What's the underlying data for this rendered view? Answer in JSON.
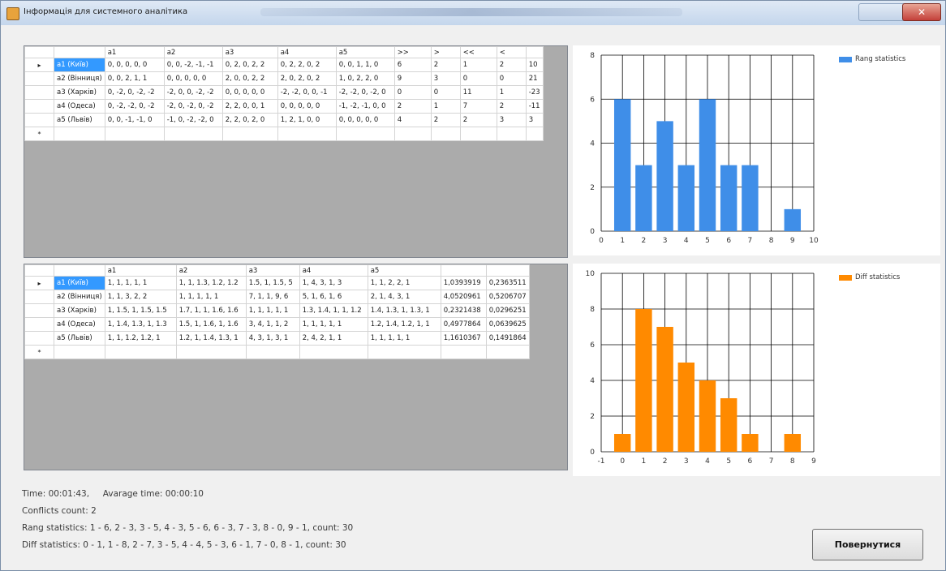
{
  "window": {
    "title": "Інформація для системного аналітика",
    "close_glyph": "✕"
  },
  "grid_top": {
    "columns": [
      "",
      "a1",
      "a2",
      "a3",
      "a4",
      "a5",
      ">>",
      ">",
      "<<",
      "<",
      ""
    ],
    "rows": [
      [
        "a1 (Київ)",
        "0, 0, 0, 0, 0",
        "0, 0, -2, -1, -1",
        "0, 2, 0, 2, 2",
        "0, 2, 2, 0, 2",
        "0, 0, 1, 1, 0",
        "6",
        "2",
        "1",
        "2",
        "10"
      ],
      [
        "a2 (Вінниця)",
        "0, 0, 2, 1, 1",
        "0, 0, 0, 0, 0",
        "2, 0, 0, 2, 2",
        "2, 0, 2, 0, 2",
        "1, 0, 2, 2, 0",
        "9",
        "3",
        "0",
        "0",
        "21"
      ],
      [
        "a3 (Харків)",
        "0, -2, 0, -2, -2",
        "-2, 0, 0, -2, -2",
        "0, 0, 0, 0, 0",
        "-2, -2, 0, 0, -1",
        "-2, -2, 0, -2, 0",
        "0",
        "0",
        "11",
        "1",
        "-23"
      ],
      [
        "a4 (Одеса)",
        "0, -2, -2, 0, -2",
        "-2, 0, -2, 0, -2",
        "2, 2, 0, 0, 1",
        "0, 0, 0, 0, 0",
        "-1, -2, -1, 0, 0",
        "2",
        "1",
        "7",
        "2",
        "-11"
      ],
      [
        "a5 (Львів)",
        "0, 0, -1, -1, 0",
        "-1, 0, -2, -2, 0",
        "2, 2, 0, 2, 0",
        "1, 2, 1, 0, 0",
        "0, 0, 0, 0, 0",
        "4",
        "2",
        "2",
        "3",
        "3"
      ]
    ],
    "row_marker": "▸",
    "new_row_marker": "*"
  },
  "grid_bottom": {
    "columns": [
      "",
      "a1",
      "a2",
      "a3",
      "a4",
      "a5",
      "",
      ""
    ],
    "rows": [
      [
        "a1 (Київ)",
        "1, 1, 1, 1, 1",
        "1, 1, 1.3, 1.2, 1.2",
        "1.5, 1, 1.5, 5",
        "1, 4, 3, 1, 3",
        "1, 1, 2, 2, 1",
        "1,0393919",
        "0,2363511"
      ],
      [
        "a2 (Вінниця)",
        "1, 1, 3, 2, 2",
        "1, 1, 1, 1, 1",
        "7, 1, 1, 9, 6",
        "5, 1, 6, 1, 6",
        "2, 1, 4, 3, 1",
        "4,0520961",
        "0,5206707"
      ],
      [
        "a3 (Харків)",
        "1, 1.5, 1, 1.5, 1.5",
        "1.7, 1, 1, 1.6, 1.6",
        "1, 1, 1, 1, 1",
        "1.3, 1.4, 1, 1, 1.2",
        "1.4, 1.3, 1, 1.3, 1",
        "0,2321438",
        "0,0296251"
      ],
      [
        "a4 (Одеса)",
        "1, 1.4, 1.3, 1, 1.3",
        "1.5, 1, 1.6, 1, 1.6",
        "3, 4, 1, 1, 2",
        "1, 1, 1, 1, 1",
        "1.2, 1.4, 1.2, 1, 1",
        "0,4977864",
        "0,0639625"
      ],
      [
        "a5 (Львів)",
        "1, 1, 1.2, 1.2, 1",
        "1.2, 1, 1.4, 1.3, 1",
        "4, 3, 1, 3, 1",
        "2, 4, 2, 1, 1",
        "1, 1, 1, 1, 1",
        "1,1610367",
        "0,1491864"
      ]
    ],
    "row_marker": "▸",
    "new_row_marker": "*"
  },
  "chart_data": [
    {
      "type": "bar",
      "legend": "Rang statistics",
      "color": "#3f8ee8",
      "x": [
        1,
        2,
        3,
        4,
        5,
        6,
        7,
        9
      ],
      "values": [
        6,
        3,
        5,
        3,
        6,
        3,
        3,
        1
      ],
      "xlim": [
        0,
        10
      ],
      "ylim": [
        0,
        8
      ],
      "xticks": [
        0,
        1,
        2,
        3,
        4,
        5,
        6,
        7,
        8,
        9,
        10
      ],
      "yticks": [
        0,
        2,
        4,
        6,
        8
      ],
      "grid": true,
      "legend_position": "top-right"
    },
    {
      "type": "bar",
      "legend": "Diff statistics",
      "color": "#ff8a00",
      "x": [
        0,
        1,
        2,
        3,
        4,
        5,
        6,
        8
      ],
      "values": [
        1,
        8,
        7,
        5,
        4,
        3,
        1,
        1
      ],
      "xlim": [
        -1,
        9
      ],
      "ylim": [
        0,
        10
      ],
      "xticks": [
        -1,
        0,
        1,
        2,
        3,
        4,
        5,
        6,
        7,
        8,
        9
      ],
      "yticks": [
        0,
        2,
        4,
        6,
        8,
        10
      ],
      "grid": true,
      "legend_position": "top-right"
    }
  ],
  "status": {
    "time": "Time: 00:01:43,",
    "avg_time": "Avarage time: 00:00:10",
    "conflicts": "Conflicts count: 2",
    "rang": "Rang statistics:  1 - 6,  2 - 3,  3 - 5,  4 - 3,  5 - 6,  6 - 3,  7 - 3,  8 - 0,  9 - 1,  count: 30",
    "diff": "Diff statistics:  0 - 1,  1 - 8,  2 - 7,  3 - 5,  4 - 4,  5 - 3,  6 - 1,  7 - 0,  8 - 1,  count: 30"
  },
  "back_button": {
    "label": "Повернутися"
  }
}
